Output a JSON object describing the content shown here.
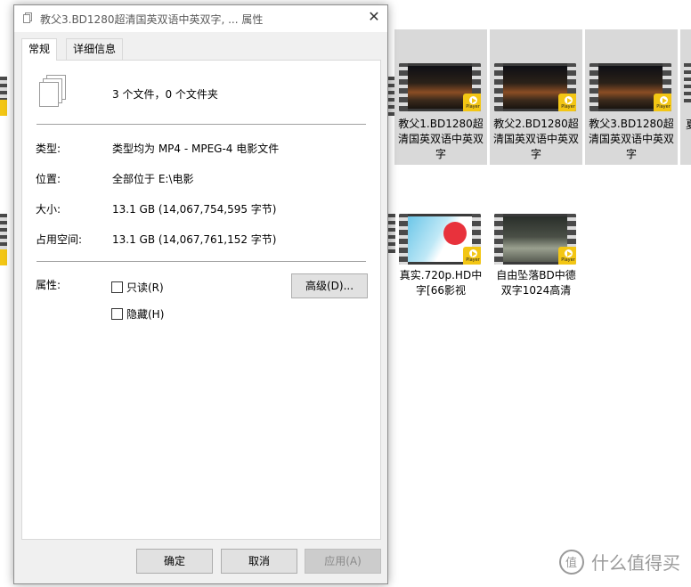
{
  "explorer": {
    "tiles": [
      {
        "label": "教父1.BD1280超清国英双语中英双字"
      },
      {
        "label": "教父2.BD1280超清国英双语中英双字"
      },
      {
        "label": "教父3.BD1280超清国英双语中英双字"
      },
      {
        "label": "真实.720p.HD中字[66影视"
      },
      {
        "label": "自由坠落BD中德双字1024高清"
      }
    ],
    "player_badge": "Player",
    "edge_partial_text": "夏"
  },
  "watermark": {
    "text": "什么值得买"
  },
  "dialog": {
    "title": "教父3.BD1280超清国英双语中英双字, ... 属性",
    "tabs": [
      "常规",
      "详细信息"
    ],
    "summary": "3 个文件，0 个文件夹",
    "rows": {
      "type": {
        "label": "类型:",
        "value": "类型均为 MP4 - MPEG-4 电影文件"
      },
      "location": {
        "label": "位置:",
        "value": "全部位于 E:\\电影"
      },
      "size": {
        "label": "大小:",
        "value": "13.1 GB (14,067,754,595 字节)"
      },
      "disk": {
        "label": "占用空间:",
        "value": "13.1 GB (14,067,761,152 字节)"
      }
    },
    "attributes": {
      "label": "属性:",
      "readonly": "只读(R)",
      "hidden": "隐藏(H)",
      "advanced": "高级(D)..."
    },
    "buttons": {
      "ok": "确定",
      "cancel": "取消",
      "apply": "应用(A)"
    }
  }
}
